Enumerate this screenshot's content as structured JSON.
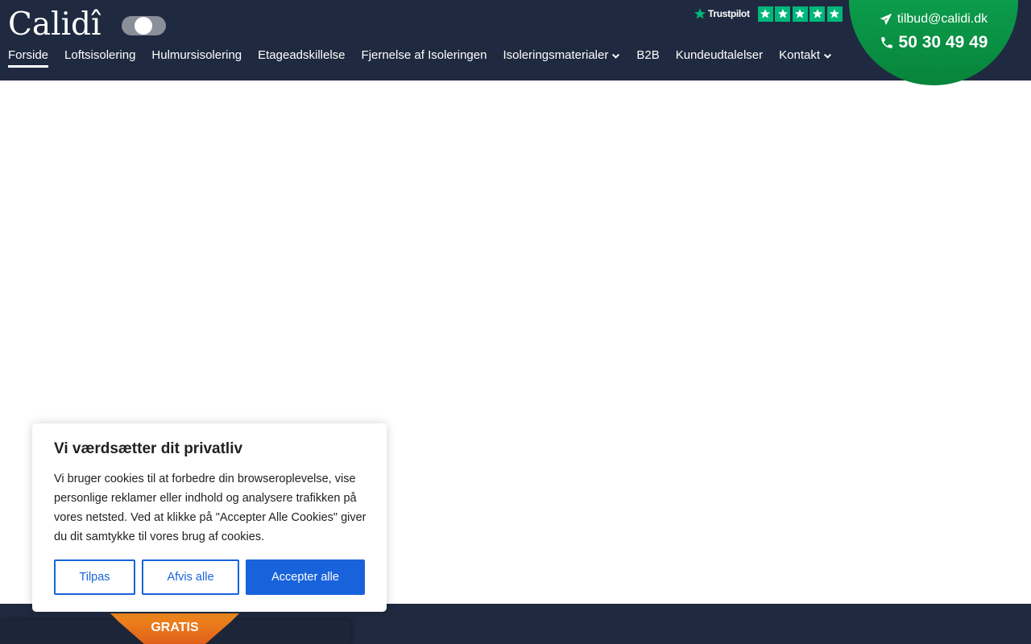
{
  "brand": {
    "logo_text": "Calidî"
  },
  "nav": {
    "items": [
      {
        "label": "Forside",
        "active": true,
        "dropdown": false
      },
      {
        "label": "Loftsisolering",
        "active": false,
        "dropdown": false
      },
      {
        "label": "Hulmursisolering",
        "active": false,
        "dropdown": false
      },
      {
        "label": "Etageadskillelse",
        "active": false,
        "dropdown": false
      },
      {
        "label": "Fjernelse af Isoleringen",
        "active": false,
        "dropdown": false
      },
      {
        "label": "Isoleringsmaterialer",
        "active": false,
        "dropdown": true
      },
      {
        "label": "B2B",
        "active": false,
        "dropdown": false
      },
      {
        "label": "Kundeudtalelser",
        "active": false,
        "dropdown": false
      },
      {
        "label": "Kontakt",
        "active": false,
        "dropdown": true
      }
    ]
  },
  "trustpilot": {
    "name": "Trustpilot",
    "rating_stars": 5
  },
  "contact": {
    "email": "tilbud@calidi.dk",
    "phone": "50 30 49 49"
  },
  "cookie_banner": {
    "title": "Vi værdsætter dit privatliv",
    "text": "Vi bruger cookies til at forbedre din browseroplevelse, vise personlige reklamer eller indhold og analysere trafikken på vores netsted. Ved at klikke på \"Accepter Alle Cookies\" giver du dit samtykke til vores brug af cookies.",
    "customize_label": "Tilpas",
    "reject_label": "Afvis alle",
    "accept_label": "Accepter alle"
  },
  "footer": {
    "badge_label": "GRATIS"
  },
  "colors": {
    "header_bg": "#1f2a40",
    "trustpilot_green": "#00b67a",
    "contact_green": "#0a9a48",
    "cookie_blue": "#1863dc",
    "badge_orange": "#e8701a"
  }
}
